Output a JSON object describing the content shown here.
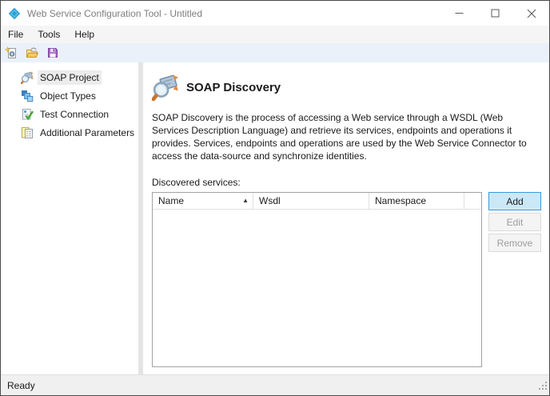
{
  "window": {
    "title": "Web Service Configuration Tool - Untitled",
    "status": "Ready",
    "controls": [
      "minimize-icon",
      "maximize-icon",
      "close-icon"
    ]
  },
  "menu": {
    "items": [
      {
        "label": "File"
      },
      {
        "label": "Tools"
      },
      {
        "label": "Help"
      }
    ]
  },
  "toolbar": {
    "icons": [
      "new-project-icon",
      "open-project-icon",
      "save-project-icon"
    ]
  },
  "sidebar": {
    "items": [
      {
        "label": "SOAP Project",
        "icon": "soap-project-icon",
        "selected": true
      },
      {
        "label": "Object Types",
        "icon": "object-types-icon",
        "selected": false
      },
      {
        "label": "Test Connection",
        "icon": "test-connection-icon",
        "selected": false
      },
      {
        "label": "Additional Parameters",
        "icon": "additional-parameters-icon",
        "selected": false
      }
    ]
  },
  "main": {
    "title": "SOAP Discovery",
    "description": "SOAP Discovery is the process of accessing a Web service through a WSDL (Web Services Description Language) and retrieve its services, endpoints and operations it provides. Services, endpoints and operations are used by the Web Service Connector to access the data-source and synchronize identities.",
    "services_label": "Discovered services:",
    "table": {
      "columns": [
        {
          "label": "Name",
          "sort": "ascending"
        },
        {
          "label": "Wsdl",
          "sort": null
        },
        {
          "label": "Namespace",
          "sort": null
        }
      ],
      "sort_indicator": "▲",
      "rows": []
    },
    "actions": [
      {
        "label": "Add",
        "enabled": true
      },
      {
        "label": "Edit",
        "enabled": false
      },
      {
        "label": "Remove",
        "enabled": false
      }
    ]
  },
  "colors": {
    "accent_button_bg": "#cbe8f7",
    "accent_button_border": "#3a99dc",
    "toolbar_bg": "#eaf1fa",
    "selection_bg": "#ececec",
    "window_border": "#4a4a4a",
    "statusbar_bg": "#f0f0f0"
  }
}
